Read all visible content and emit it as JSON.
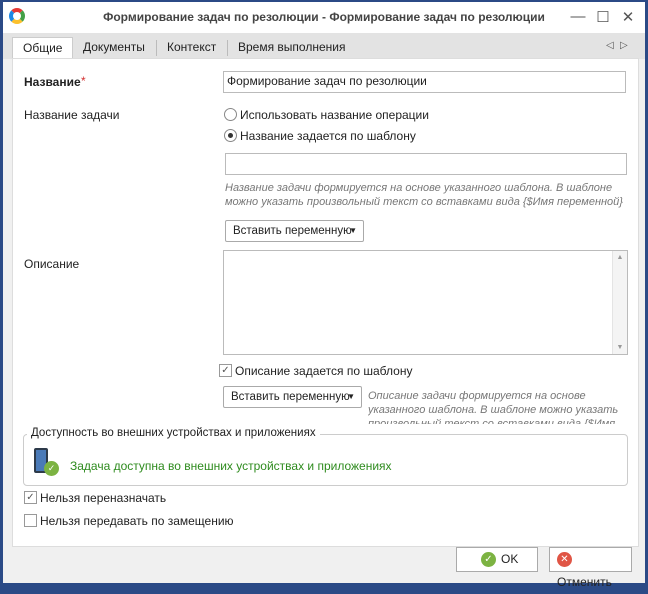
{
  "window": {
    "title": "Формирование задач по резолюции - Формирование задач по резолюции",
    "minimize": "—",
    "maximize": "☐",
    "close": "✕"
  },
  "tabs": [
    {
      "label": "Общие"
    },
    {
      "label": "Документы"
    },
    {
      "label": "Контекст"
    },
    {
      "label": "Время выполнения"
    }
  ],
  "tab_nav": {
    "prev": "◁",
    "next": "▷"
  },
  "form": {
    "name_label": "Название",
    "required_mark": "*",
    "name_value": "Формирование задач по резолюции",
    "task_name_label": "Название задачи",
    "radio_use_operation": "Использовать название операции",
    "radio_template": "Название задается по шаблону",
    "template_value": "",
    "template_hint": "Название задачи формируется на основе указанного шаблона. В шаблоне можно указать произвольный текст со вставками вида {$Имя переменной}",
    "insert_variable": "Вставить переменную",
    "description_label": "Описание",
    "description_value": "",
    "desc_template_checkbox": "Описание задается по шаблону",
    "desc_hint": "Описание задачи формируется на основе указанного шаблона. В шаблоне можно указать произвольный текст со вставками вида {$Имя переменной}",
    "group_title": "Доступность во внешних устройствах и приложениях",
    "availability_text": "Задача доступна во внешних устройствах и приложениях",
    "no_reassign": "Нельзя переназначать",
    "no_delegate": "Нельзя передавать по замещению"
  },
  "footer": {
    "ok": "OK",
    "cancel": "Отменить"
  },
  "colors": {
    "border": "#2b4a86",
    "green": "#2e8b1e",
    "hint": "#777777"
  }
}
